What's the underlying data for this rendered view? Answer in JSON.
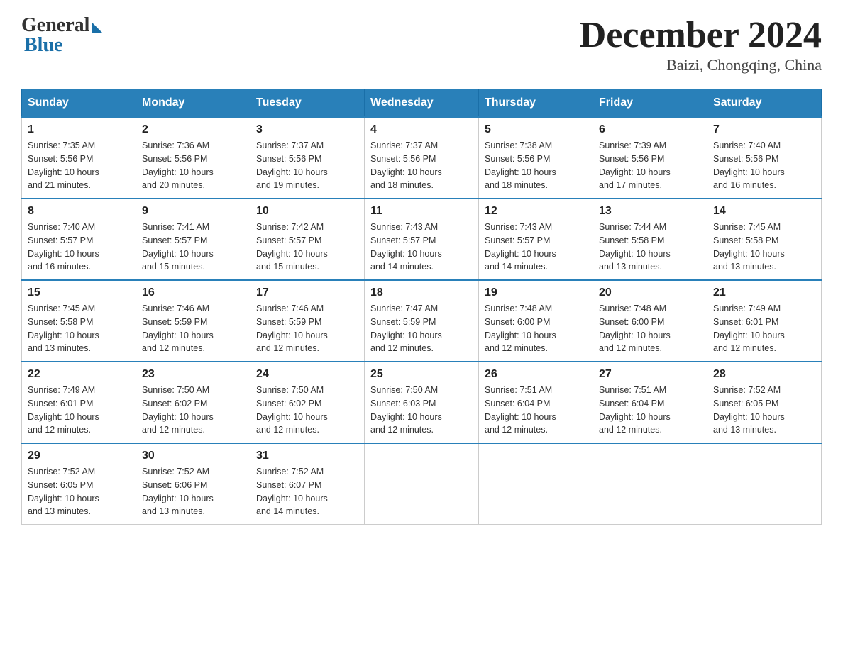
{
  "logo": {
    "general": "General",
    "blue": "Blue"
  },
  "title": "December 2024",
  "location": "Baizi, Chongqing, China",
  "days_of_week": [
    "Sunday",
    "Monday",
    "Tuesday",
    "Wednesday",
    "Thursday",
    "Friday",
    "Saturday"
  ],
  "weeks": [
    [
      {
        "day": "1",
        "sunrise": "7:35 AM",
        "sunset": "5:56 PM",
        "daylight": "10 hours and 21 minutes."
      },
      {
        "day": "2",
        "sunrise": "7:36 AM",
        "sunset": "5:56 PM",
        "daylight": "10 hours and 20 minutes."
      },
      {
        "day": "3",
        "sunrise": "7:37 AM",
        "sunset": "5:56 PM",
        "daylight": "10 hours and 19 minutes."
      },
      {
        "day": "4",
        "sunrise": "7:37 AM",
        "sunset": "5:56 PM",
        "daylight": "10 hours and 18 minutes."
      },
      {
        "day": "5",
        "sunrise": "7:38 AM",
        "sunset": "5:56 PM",
        "daylight": "10 hours and 18 minutes."
      },
      {
        "day": "6",
        "sunrise": "7:39 AM",
        "sunset": "5:56 PM",
        "daylight": "10 hours and 17 minutes."
      },
      {
        "day": "7",
        "sunrise": "7:40 AM",
        "sunset": "5:56 PM",
        "daylight": "10 hours and 16 minutes."
      }
    ],
    [
      {
        "day": "8",
        "sunrise": "7:40 AM",
        "sunset": "5:57 PM",
        "daylight": "10 hours and 16 minutes."
      },
      {
        "day": "9",
        "sunrise": "7:41 AM",
        "sunset": "5:57 PM",
        "daylight": "10 hours and 15 minutes."
      },
      {
        "day": "10",
        "sunrise": "7:42 AM",
        "sunset": "5:57 PM",
        "daylight": "10 hours and 15 minutes."
      },
      {
        "day": "11",
        "sunrise": "7:43 AM",
        "sunset": "5:57 PM",
        "daylight": "10 hours and 14 minutes."
      },
      {
        "day": "12",
        "sunrise": "7:43 AM",
        "sunset": "5:57 PM",
        "daylight": "10 hours and 14 minutes."
      },
      {
        "day": "13",
        "sunrise": "7:44 AM",
        "sunset": "5:58 PM",
        "daylight": "10 hours and 13 minutes."
      },
      {
        "day": "14",
        "sunrise": "7:45 AM",
        "sunset": "5:58 PM",
        "daylight": "10 hours and 13 minutes."
      }
    ],
    [
      {
        "day": "15",
        "sunrise": "7:45 AM",
        "sunset": "5:58 PM",
        "daylight": "10 hours and 13 minutes."
      },
      {
        "day": "16",
        "sunrise": "7:46 AM",
        "sunset": "5:59 PM",
        "daylight": "10 hours and 12 minutes."
      },
      {
        "day": "17",
        "sunrise": "7:46 AM",
        "sunset": "5:59 PM",
        "daylight": "10 hours and 12 minutes."
      },
      {
        "day": "18",
        "sunrise": "7:47 AM",
        "sunset": "5:59 PM",
        "daylight": "10 hours and 12 minutes."
      },
      {
        "day": "19",
        "sunrise": "7:48 AM",
        "sunset": "6:00 PM",
        "daylight": "10 hours and 12 minutes."
      },
      {
        "day": "20",
        "sunrise": "7:48 AM",
        "sunset": "6:00 PM",
        "daylight": "10 hours and 12 minutes."
      },
      {
        "day": "21",
        "sunrise": "7:49 AM",
        "sunset": "6:01 PM",
        "daylight": "10 hours and 12 minutes."
      }
    ],
    [
      {
        "day": "22",
        "sunrise": "7:49 AM",
        "sunset": "6:01 PM",
        "daylight": "10 hours and 12 minutes."
      },
      {
        "day": "23",
        "sunrise": "7:50 AM",
        "sunset": "6:02 PM",
        "daylight": "10 hours and 12 minutes."
      },
      {
        "day": "24",
        "sunrise": "7:50 AM",
        "sunset": "6:02 PM",
        "daylight": "10 hours and 12 minutes."
      },
      {
        "day": "25",
        "sunrise": "7:50 AM",
        "sunset": "6:03 PM",
        "daylight": "10 hours and 12 minutes."
      },
      {
        "day": "26",
        "sunrise": "7:51 AM",
        "sunset": "6:04 PM",
        "daylight": "10 hours and 12 minutes."
      },
      {
        "day": "27",
        "sunrise": "7:51 AM",
        "sunset": "6:04 PM",
        "daylight": "10 hours and 12 minutes."
      },
      {
        "day": "28",
        "sunrise": "7:52 AM",
        "sunset": "6:05 PM",
        "daylight": "10 hours and 13 minutes."
      }
    ],
    [
      {
        "day": "29",
        "sunrise": "7:52 AM",
        "sunset": "6:05 PM",
        "daylight": "10 hours and 13 minutes."
      },
      {
        "day": "30",
        "sunrise": "7:52 AM",
        "sunset": "6:06 PM",
        "daylight": "10 hours and 13 minutes."
      },
      {
        "day": "31",
        "sunrise": "7:52 AM",
        "sunset": "6:07 PM",
        "daylight": "10 hours and 14 minutes."
      },
      null,
      null,
      null,
      null
    ]
  ],
  "labels": {
    "sunrise": "Sunrise:",
    "sunset": "Sunset:",
    "daylight": "Daylight:"
  }
}
